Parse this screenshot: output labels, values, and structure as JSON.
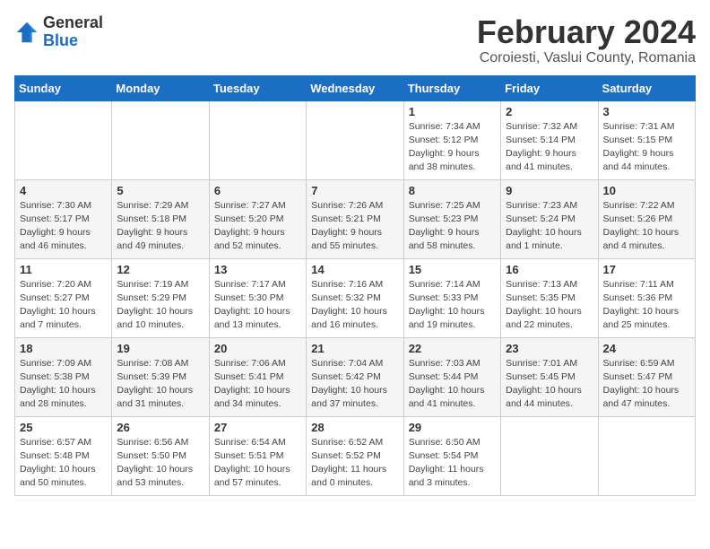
{
  "header": {
    "logo_general": "General",
    "logo_blue": "Blue",
    "calendar_title": "February 2024",
    "calendar_subtitle": "Coroiesti, Vaslui County, Romania"
  },
  "days_of_week": [
    "Sunday",
    "Monday",
    "Tuesday",
    "Wednesday",
    "Thursday",
    "Friday",
    "Saturday"
  ],
  "weeks": [
    [
      {
        "day": "",
        "info": ""
      },
      {
        "day": "",
        "info": ""
      },
      {
        "day": "",
        "info": ""
      },
      {
        "day": "",
        "info": ""
      },
      {
        "day": "1",
        "info": "Sunrise: 7:34 AM\nSunset: 5:12 PM\nDaylight: 9 hours\nand 38 minutes."
      },
      {
        "day": "2",
        "info": "Sunrise: 7:32 AM\nSunset: 5:14 PM\nDaylight: 9 hours\nand 41 minutes."
      },
      {
        "day": "3",
        "info": "Sunrise: 7:31 AM\nSunset: 5:15 PM\nDaylight: 9 hours\nand 44 minutes."
      }
    ],
    [
      {
        "day": "4",
        "info": "Sunrise: 7:30 AM\nSunset: 5:17 PM\nDaylight: 9 hours\nand 46 minutes."
      },
      {
        "day": "5",
        "info": "Sunrise: 7:29 AM\nSunset: 5:18 PM\nDaylight: 9 hours\nand 49 minutes."
      },
      {
        "day": "6",
        "info": "Sunrise: 7:27 AM\nSunset: 5:20 PM\nDaylight: 9 hours\nand 52 minutes."
      },
      {
        "day": "7",
        "info": "Sunrise: 7:26 AM\nSunset: 5:21 PM\nDaylight: 9 hours\nand 55 minutes."
      },
      {
        "day": "8",
        "info": "Sunrise: 7:25 AM\nSunset: 5:23 PM\nDaylight: 9 hours\nand 58 minutes."
      },
      {
        "day": "9",
        "info": "Sunrise: 7:23 AM\nSunset: 5:24 PM\nDaylight: 10 hours\nand 1 minute."
      },
      {
        "day": "10",
        "info": "Sunrise: 7:22 AM\nSunset: 5:26 PM\nDaylight: 10 hours\nand 4 minutes."
      }
    ],
    [
      {
        "day": "11",
        "info": "Sunrise: 7:20 AM\nSunset: 5:27 PM\nDaylight: 10 hours\nand 7 minutes."
      },
      {
        "day": "12",
        "info": "Sunrise: 7:19 AM\nSunset: 5:29 PM\nDaylight: 10 hours\nand 10 minutes."
      },
      {
        "day": "13",
        "info": "Sunrise: 7:17 AM\nSunset: 5:30 PM\nDaylight: 10 hours\nand 13 minutes."
      },
      {
        "day": "14",
        "info": "Sunrise: 7:16 AM\nSunset: 5:32 PM\nDaylight: 10 hours\nand 16 minutes."
      },
      {
        "day": "15",
        "info": "Sunrise: 7:14 AM\nSunset: 5:33 PM\nDaylight: 10 hours\nand 19 minutes."
      },
      {
        "day": "16",
        "info": "Sunrise: 7:13 AM\nSunset: 5:35 PM\nDaylight: 10 hours\nand 22 minutes."
      },
      {
        "day": "17",
        "info": "Sunrise: 7:11 AM\nSunset: 5:36 PM\nDaylight: 10 hours\nand 25 minutes."
      }
    ],
    [
      {
        "day": "18",
        "info": "Sunrise: 7:09 AM\nSunset: 5:38 PM\nDaylight: 10 hours\nand 28 minutes."
      },
      {
        "day": "19",
        "info": "Sunrise: 7:08 AM\nSunset: 5:39 PM\nDaylight: 10 hours\nand 31 minutes."
      },
      {
        "day": "20",
        "info": "Sunrise: 7:06 AM\nSunset: 5:41 PM\nDaylight: 10 hours\nand 34 minutes."
      },
      {
        "day": "21",
        "info": "Sunrise: 7:04 AM\nSunset: 5:42 PM\nDaylight: 10 hours\nand 37 minutes."
      },
      {
        "day": "22",
        "info": "Sunrise: 7:03 AM\nSunset: 5:44 PM\nDaylight: 10 hours\nand 41 minutes."
      },
      {
        "day": "23",
        "info": "Sunrise: 7:01 AM\nSunset: 5:45 PM\nDaylight: 10 hours\nand 44 minutes."
      },
      {
        "day": "24",
        "info": "Sunrise: 6:59 AM\nSunset: 5:47 PM\nDaylight: 10 hours\nand 47 minutes."
      }
    ],
    [
      {
        "day": "25",
        "info": "Sunrise: 6:57 AM\nSunset: 5:48 PM\nDaylight: 10 hours\nand 50 minutes."
      },
      {
        "day": "26",
        "info": "Sunrise: 6:56 AM\nSunset: 5:50 PM\nDaylight: 10 hours\nand 53 minutes."
      },
      {
        "day": "27",
        "info": "Sunrise: 6:54 AM\nSunset: 5:51 PM\nDaylight: 10 hours\nand 57 minutes."
      },
      {
        "day": "28",
        "info": "Sunrise: 6:52 AM\nSunset: 5:52 PM\nDaylight: 11 hours\nand 0 minutes."
      },
      {
        "day": "29",
        "info": "Sunrise: 6:50 AM\nSunset: 5:54 PM\nDaylight: 11 hours\nand 3 minutes."
      },
      {
        "day": "",
        "info": ""
      },
      {
        "day": "",
        "info": ""
      }
    ]
  ]
}
